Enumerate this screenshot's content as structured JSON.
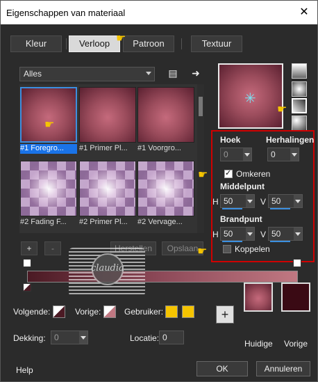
{
  "window": {
    "title": "Eigenschappen van materiaal",
    "close": "✕"
  },
  "tabs": [
    {
      "label": "Kleur"
    },
    {
      "label": "Verloop"
    },
    {
      "label": "Patroon"
    },
    {
      "label": "Textuur"
    }
  ],
  "gallery": {
    "filter": "Alles",
    "items": [
      {
        "label": "#1 Foregro..."
      },
      {
        "label": "#1 Primer Pl..."
      },
      {
        "label": "#1 Voorgro..."
      },
      {
        "label": "#2 Fading F..."
      },
      {
        "label": "#2 Primer Pl..."
      },
      {
        "label": "#2 Vervage..."
      }
    ],
    "add_label": "+",
    "remove_label": "-",
    "restore_label": "Herstellen",
    "save_label": "Opslaan"
  },
  "settings": {
    "hoek_label": "Hoek",
    "hoek_value": "0",
    "herhalingen_label": "Herhalingen",
    "herhalingen_value": "0",
    "omkeren_label": "Omkeren",
    "middelpunt_label": "Middelpunt",
    "middel_h_label": "H",
    "middel_h_value": "50",
    "middel_v_label": "V",
    "middel_v_value": "50",
    "brandpunt_label": "Brandpunt",
    "brand_h_label": "H",
    "brand_h_value": "50",
    "brand_v_label": "V",
    "brand_v_value": "50",
    "koppelen_label": "Koppelen"
  },
  "bottom": {
    "volgende_label": "Volgende:",
    "vorige_label": "Vorige:",
    "gebruiker_label": "Gebruiker:",
    "dekking_label": "Dekking:",
    "dekking_value": "0",
    "locatie_label": "Locatie:",
    "locatie_value": "0",
    "huidige_label": "Huidige",
    "vorige_swatch_label": "Vorige",
    "add_label": "+"
  },
  "footer": {
    "help": "Help",
    "ok": "OK",
    "cancel": "Annuleren"
  },
  "watermark": {
    "text": "claudia"
  },
  "colors": {
    "gradient_dark": "#4b1a24",
    "gradient_light": "#c07882",
    "accent": "#1a73e8",
    "highlight_box": "#d00000",
    "user_color": "#f5c400",
    "vorige_color": "#3a0a14"
  }
}
